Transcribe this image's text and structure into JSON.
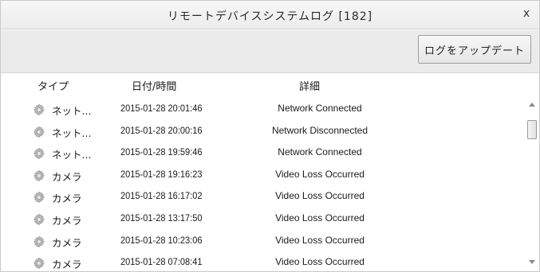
{
  "window": {
    "title": "リモートデバイスシステムログ [182]",
    "close_label": "x"
  },
  "toolbar": {
    "update_label": "ログをアップデート"
  },
  "table": {
    "columns": [
      "タイプ",
      "日付/時間",
      "詳細"
    ],
    "rows": [
      {
        "icon": "gear-icon",
        "type": "ネット...",
        "datetime": "2015-01-28 20:01:46",
        "detail": "Network Connected"
      },
      {
        "icon": "gear-icon",
        "type": "ネット...",
        "datetime": "2015-01-28 20:00:16",
        "detail": "Network Disconnected"
      },
      {
        "icon": "gear-icon",
        "type": "ネット...",
        "datetime": "2015-01-28 19:59:46",
        "detail": "Network Connected"
      },
      {
        "icon": "gear-icon",
        "type": "カメラ",
        "datetime": "2015-01-28 19:16:23",
        "detail": "Video Loss Occurred"
      },
      {
        "icon": "gear-icon",
        "type": "カメラ",
        "datetime": "2015-01-28 16:17:02",
        "detail": "Video Loss Occurred"
      },
      {
        "icon": "gear-icon",
        "type": "カメラ",
        "datetime": "2015-01-28 13:17:50",
        "detail": "Video Loss Occurred"
      },
      {
        "icon": "gear-icon",
        "type": "カメラ",
        "datetime": "2015-01-28 10:23:06",
        "detail": "Video Loss Occurred"
      },
      {
        "icon": "gear-icon",
        "type": "カメラ",
        "datetime": "2015-01-28 07:08:41",
        "detail": "Video Loss Occurred"
      }
    ]
  },
  "scrollbar": {
    "up_icon": "arrow-up-icon",
    "down_icon": "arrow-down-icon"
  }
}
